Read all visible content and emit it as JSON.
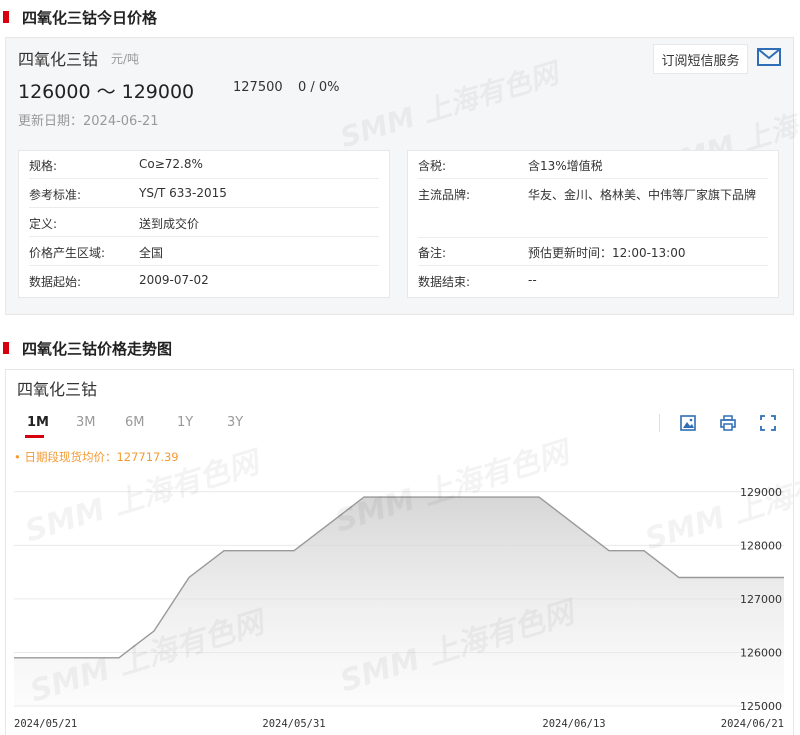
{
  "section1": {
    "title": "四氧化三钴今日价格"
  },
  "price": {
    "name": "四氧化三钴",
    "unit": "元/吨",
    "range": "126000 ～ 129000",
    "average": "127500",
    "change": "0 / 0%",
    "updated": "更新日期：2024-06-21",
    "subscribe_label": "订阅短信服务",
    "icon": "mail-icon"
  },
  "specs_left": [
    {
      "k": "规格:",
      "v": "Co≥72.8%"
    },
    {
      "k": "参考标准:",
      "v": "YS/T 633-2015"
    },
    {
      "k": "定义:",
      "v": "送到成交价"
    },
    {
      "k": "价格产生区域:",
      "v": "全国"
    },
    {
      "k": "数据起始:",
      "v": "2009-07-02"
    }
  ],
  "specs_right": [
    {
      "k": "含税:",
      "v": "含13%增值税"
    },
    {
      "k": "主流品牌:",
      "v": "华友、金川、格林美、中伟等厂家旗下品牌"
    },
    {
      "k": "备注:",
      "v": "预估更新时间：12:00-13:00"
    },
    {
      "k": "数据结束:",
      "v": "--"
    }
  ],
  "section2": {
    "title": "四氧化三钴价格走势图"
  },
  "chart_panel": {
    "title": "四氧化三钴",
    "tabs": [
      "1M",
      "3M",
      "6M",
      "1Y",
      "3Y"
    ],
    "active_tab": "1M",
    "tools": [
      "image-icon",
      "print-icon",
      "fullscreen-icon"
    ],
    "avg_label": "• 日期段现货均价：127717.39"
  },
  "watermark": "SMM 上海有色网",
  "colors": {
    "accent": "#d7000f",
    "avg_text": "#f39a33",
    "line": "#999999"
  },
  "chart_data": {
    "type": "area",
    "x": [
      "2024/05/21",
      "2024/05/22",
      "2024/05/23",
      "2024/05/24",
      "2024/05/27",
      "2024/05/28",
      "2024/05/29",
      "2024/05/30",
      "2024/05/31",
      "2024/06/03",
      "2024/06/04",
      "2024/06/05",
      "2024/06/06",
      "2024/06/07",
      "2024/06/11",
      "2024/06/12",
      "2024/06/13",
      "2024/06/14",
      "2024/06/17",
      "2024/06/18",
      "2024/06/19",
      "2024/06/20",
      "2024/06/21"
    ],
    "y": [
      125900,
      125900,
      125900,
      125900,
      126400,
      127400,
      127900,
      127900,
      127900,
      128400,
      128900,
      128900,
      128900,
      128900,
      128900,
      128900,
      128400,
      127900,
      127900,
      127400,
      127400,
      127400,
      127400
    ],
    "ylim": [
      125000,
      129500
    ],
    "y_ticks": [
      125000,
      126000,
      127000,
      128000,
      129000
    ],
    "x_tick_labels": [
      "2024/05/21",
      "2024/05/31",
      "2024/06/13",
      "2024/06/21"
    ],
    "grid": true,
    "legend": "none"
  }
}
